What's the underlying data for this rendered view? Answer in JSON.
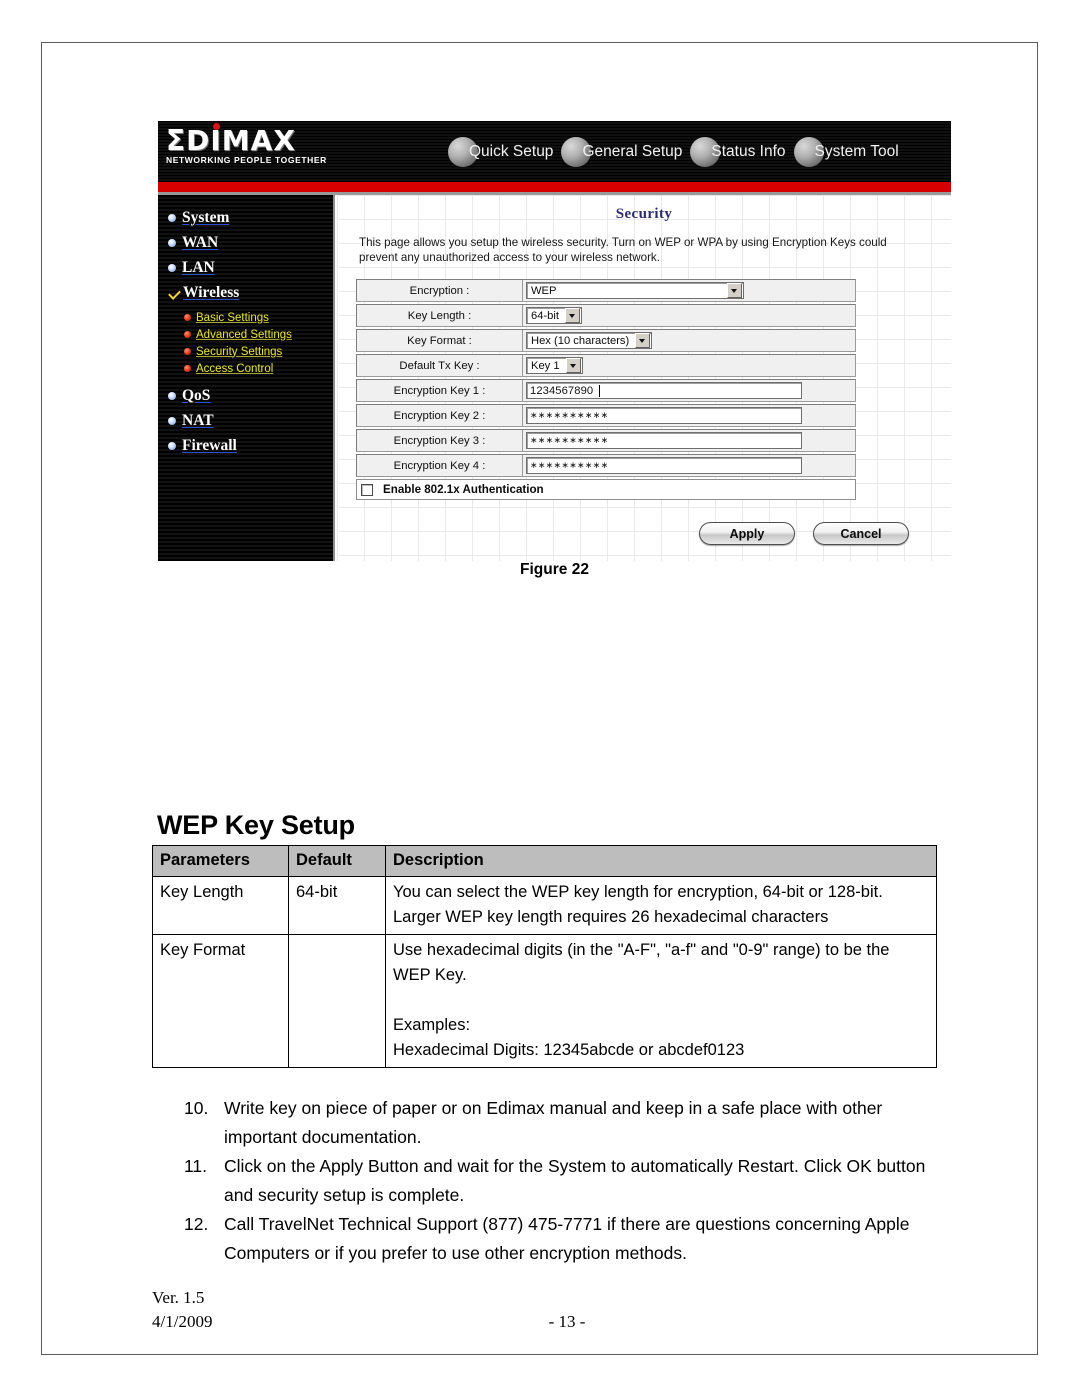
{
  "document": {
    "figure_caption": "Figure 22",
    "section_heading": "WEP Key Setup",
    "footer": {
      "version": "Ver. 1.5",
      "date": "4/1/2009",
      "page_number": "- 13 -"
    }
  },
  "router_ui": {
    "brand": {
      "name": "ΣDIMAX",
      "tagline": "NETWORKING PEOPLE TOGETHER"
    },
    "tabs": [
      {
        "label": "Quick Setup",
        "icon": "globe-icon"
      },
      {
        "label": "General Setup",
        "icon": "globe-icon"
      },
      {
        "label": "Status Info",
        "icon": "globe-icon"
      },
      {
        "label": "System Tool",
        "icon": "globe-icon"
      }
    ],
    "sidebar": {
      "items": [
        {
          "label": "System",
          "icon": "blue-bullet-icon",
          "selected": false
        },
        {
          "label": "WAN",
          "icon": "blue-bullet-icon",
          "selected": false
        },
        {
          "label": "LAN",
          "icon": "blue-bullet-icon",
          "selected": false
        },
        {
          "label": "Wireless",
          "icon": "yellow-check-icon",
          "selected": true
        },
        {
          "label": "QoS",
          "icon": "blue-bullet-icon",
          "selected": false
        },
        {
          "label": "NAT",
          "icon": "blue-bullet-icon",
          "selected": false
        },
        {
          "label": "Firewall",
          "icon": "blue-bullet-icon",
          "selected": false
        }
      ],
      "sub_items": [
        {
          "label": "Basic Settings",
          "icon": "red-bullet-icon"
        },
        {
          "label": "Advanced Settings",
          "icon": "red-bullet-icon"
        },
        {
          "label": "Security Settings",
          "icon": "red-bullet-icon"
        },
        {
          "label": "Access Control",
          "icon": "red-bullet-icon"
        }
      ]
    },
    "panel": {
      "title": "Security",
      "description": "This page allows you setup the wireless security. Turn on WEP or WPA by using Encryption Keys could prevent any unauthorized access to your wireless network.",
      "fields": [
        {
          "label": "Encryption :",
          "type": "select",
          "value": "WEP"
        },
        {
          "label": "Key Length :",
          "type": "select",
          "value": "64-bit"
        },
        {
          "label": "Key Format :",
          "type": "select",
          "value": "Hex (10 characters)"
        },
        {
          "label": "Default Tx Key :",
          "type": "select",
          "value": "Key 1"
        },
        {
          "label": "Encryption Key 1 :",
          "type": "text",
          "value": "1234567890"
        },
        {
          "label": "Encryption Key 2 :",
          "type": "password",
          "value": "∗∗∗∗∗∗∗∗∗∗"
        },
        {
          "label": "Encryption Key 3 :",
          "type": "password",
          "value": "∗∗∗∗∗∗∗∗∗∗"
        },
        {
          "label": "Encryption Key 4 :",
          "type": "password",
          "value": "∗∗∗∗∗∗∗∗∗∗"
        }
      ],
      "auth_checkbox": {
        "label": "Enable 802.1x Authentication",
        "checked": false
      },
      "buttons": {
        "apply": "Apply",
        "cancel": "Cancel"
      }
    },
    "colors": {
      "accent_red": "#d60000",
      "header_black": "#000000",
      "title_blue": "#2c2c6e",
      "sub_link_yellow": "#e8e53a"
    }
  },
  "wep_table": {
    "headers": [
      "Parameters",
      "Default",
      "Description"
    ],
    "rows": [
      {
        "parameter": "Key Length",
        "default": "64-bit",
        "description": "You can select the WEP key length for encryption, 64-bit or 128-bit. Larger WEP key length requires 26 hexadecimal characters"
      },
      {
        "parameter": "Key Format",
        "default": "",
        "description": "Use hexadecimal digits (in the \"A-F\", \"a-f\" and \"0-9\" range) to be the WEP Key.\n\nExamples:\nHexadecimal Digits: 12345abcde or abcdef0123"
      }
    ]
  },
  "steps": [
    {
      "number": "10.",
      "text": "Write key on piece of paper or on Edimax manual and keep in a safe place with other important documentation."
    },
    {
      "number": "11. ",
      "text": "Click on the Apply Button and wait for the System to automatically Restart.  Click OK button and security setup is complete."
    },
    {
      "number": "12.",
      "text": "Call TravelNet Technical Support (877) 475-7771 if there are questions concerning Apple Computers or if you prefer to use other encryption methods."
    }
  ]
}
